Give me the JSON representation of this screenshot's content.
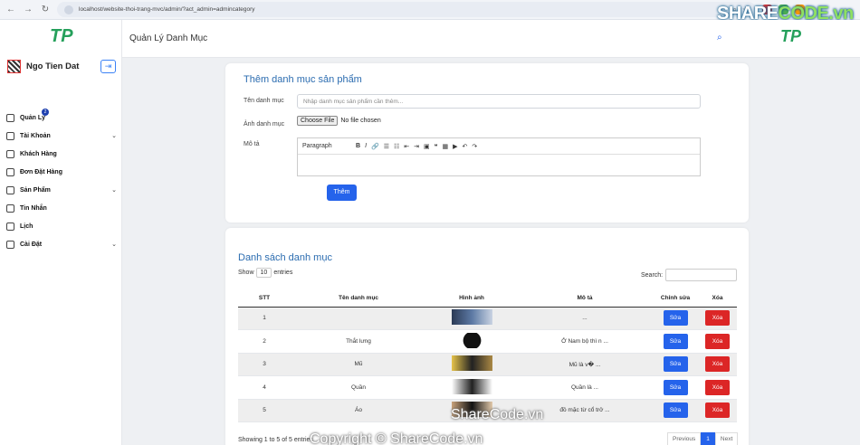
{
  "browser": {
    "url": "localhost/website-thoi-trang-mvc/admin/?act_admin=admincategory",
    "profile_initial": "K"
  },
  "brand": {
    "part1": "SHARE",
    "part2": "CODE.vn"
  },
  "sidebar": {
    "logo": "TP",
    "user": "Ngo Tien Dat",
    "badge": "2",
    "items": [
      {
        "label": "Quản Lý",
        "chevron": ""
      },
      {
        "label": "Tài Khoản",
        "chevron": "⌄"
      },
      {
        "label": "Khách Hàng",
        "chevron": ""
      },
      {
        "label": "Đơn Đặt Hàng",
        "chevron": ""
      },
      {
        "label": "Sản Phẩm",
        "chevron": "⌄"
      },
      {
        "label": "Tin Nhắn",
        "chevron": ""
      },
      {
        "label": "Lịch",
        "chevron": ""
      },
      {
        "label": "Cài Đặt",
        "chevron": "⌄"
      }
    ]
  },
  "header": {
    "title": "Quản Lý Danh Mục"
  },
  "form": {
    "title": "Thêm danh mục sản phẩm",
    "name_label": "Tên danh mục",
    "name_placeholder": "Nhập danh mục sản phẩm cần thêm...",
    "image_label": "Ảnh danh mục",
    "file_button": "Choose File",
    "file_status": "No file chosen",
    "desc_label": "Mô tả",
    "paragraph": "Paragraph",
    "submit": "Thêm"
  },
  "list": {
    "title": "Danh sách danh mục",
    "show": "Show",
    "entries_value": "10",
    "entries": "entries",
    "search_label": "Search:",
    "columns": [
      "STT",
      "Tên danh mục",
      "Hình ảnh",
      "Mô tả",
      "Chỉnh sửa",
      "Xóa"
    ],
    "rows": [
      {
        "stt": "1",
        "name": "",
        "desc": "..."
      },
      {
        "stt": "2",
        "name": "Thắt lưng",
        "desc": "Ở Nam bộ thì n ..."
      },
      {
        "stt": "3",
        "name": "Mũ",
        "desc": "Mũ là v� ..."
      },
      {
        "stt": "4",
        "name": "Quần",
        "desc": "Quần là ..."
      },
      {
        "stt": "5",
        "name": "Áo",
        "desc": "đồ mặc từ cổ trở ..."
      }
    ],
    "edit_label": "Sửa",
    "delete_label": "Xóa",
    "info": "Showing 1 to 5 of 5 entries",
    "prev": "Previous",
    "page": "1",
    "next": "Next"
  },
  "watermark": {
    "center": "ShareCode.vn",
    "bottom": "Copyright © ShareCode.vn"
  }
}
